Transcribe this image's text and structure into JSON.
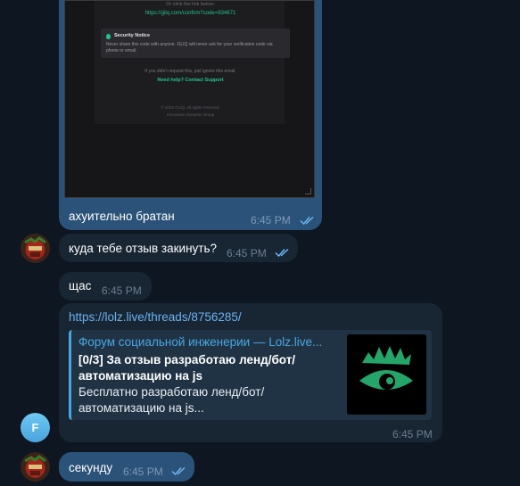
{
  "email_screenshot": {
    "or_click": "Or click the link below:",
    "confirm_link": "https://gliq.com/confirm?code=934671",
    "security_title": "Security Notice",
    "security_text": "Never share this code with anyone. GLIQ will never ask for your verification code via phone or email.",
    "ignore_text": "If you didn't request this, just ignore this email.",
    "help_link": "Need help? Contact Support",
    "copyright": "© 2025 GLIQ. All rights reserved.",
    "company": "Innovation Dynamic Group"
  },
  "messages": [
    {
      "text": "ахуительно братан",
      "time": "6:45 PM"
    },
    {
      "text": "куда тебе отзыв закинуть?",
      "time": "6:45 PM"
    },
    {
      "text": "щас",
      "time": "6:45 PM"
    },
    {
      "link": "https://lolz.live/threads/8756285/",
      "preview": {
        "site": "Форум социальной инженерии — Lolz.live...",
        "title": "[0/3] За отзыв разработаю ленд/бот/автоматизацию на js",
        "description": "Бесплатно разработаю ленд/бот/автоматизацию на js..."
      },
      "time": "6:45 PM"
    },
    {
      "text": "секунду",
      "time": "6:45 PM"
    }
  ],
  "avatars": {
    "contact_initial": "F"
  },
  "colors": {
    "background": "#0e1621",
    "outgoing_bubble": "#2b5278",
    "incoming_bubble": "#182533",
    "link": "#6ab3f3",
    "accent_green": "#22c38e"
  }
}
